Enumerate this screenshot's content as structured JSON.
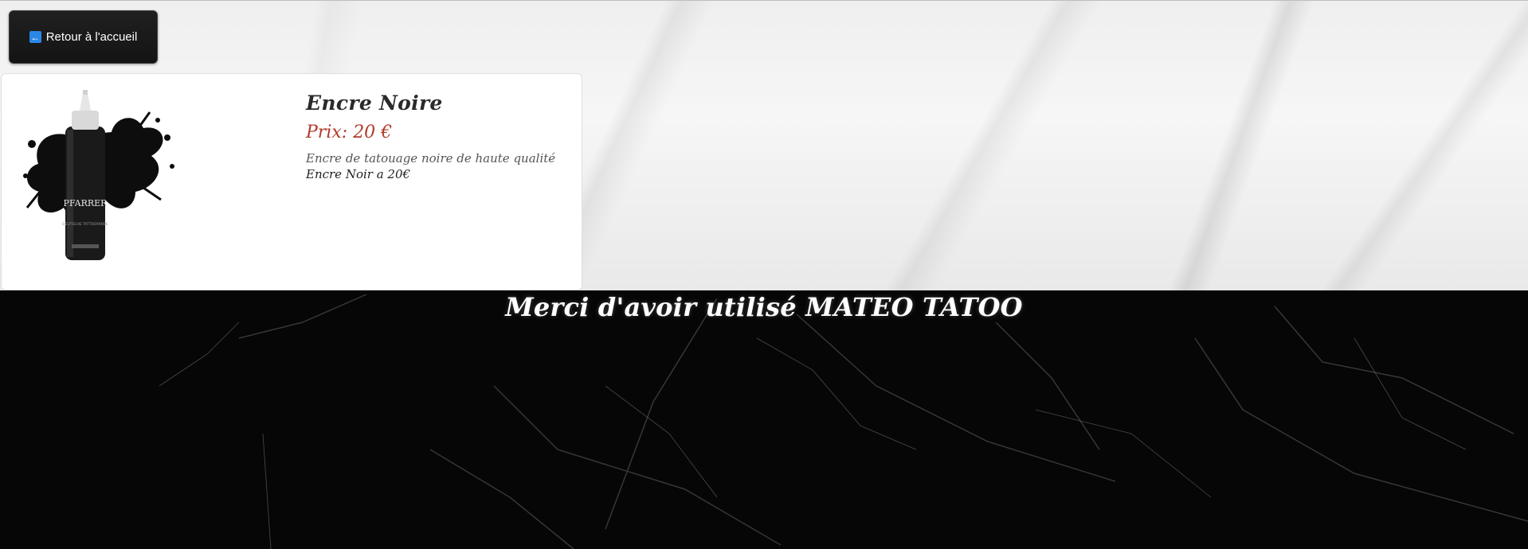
{
  "navigation": {
    "back_label": "Retour à l'accueil",
    "back_icon": "arrow-left-icon"
  },
  "product": {
    "name": "Encre Noire",
    "price_prefix": "Prix:",
    "price_value": "20 €",
    "description": "Encre de tatouage noire de haute qualité",
    "note": "Encre Noir a 20€",
    "image_brand": "PFARRER",
    "image_subtext": "DEUTSCHE TATTOOFARBE"
  },
  "footer": {
    "message": "Merci d'avoir utilisé MATEO TATOO"
  },
  "colors": {
    "price": "#b23a2a",
    "accent_icon": "#2b87e6",
    "footer_bg": "#060606"
  }
}
